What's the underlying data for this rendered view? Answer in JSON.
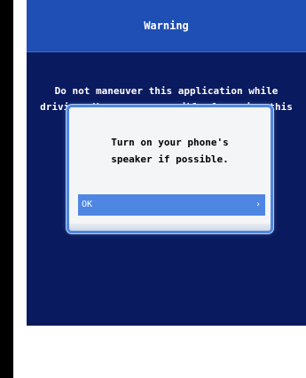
{
  "title_bar": {
    "title": "Warning"
  },
  "warning": {
    "text": "Do not maneuver this application while\ndriving. You are responsible for using this"
  },
  "dialog": {
    "message": "Turn on your phone's\nspeaker if possible.",
    "ok_label": "OK",
    "chevron": "›"
  },
  "colors": {
    "title_bar_bg": "#1f4fb4",
    "content_bg": "#0a1a5e",
    "dialog_border": "#4e87e0",
    "button_bg": "#4e86e4"
  },
  "icons": {
    "ok_button_arrow": "chevron-right-icon"
  }
}
